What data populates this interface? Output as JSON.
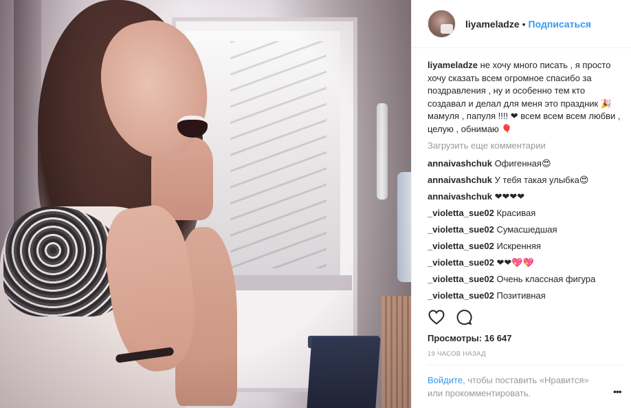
{
  "header": {
    "username": "liyameladze",
    "separator": "•",
    "follow_label": "Подписаться"
  },
  "caption": {
    "username": "liyameladze",
    "text": "не хочу много писать , я просто хочу сказать всем огромное спасибо за поздравления , ну и особенно тем кто создавал и делал для меня это праздник 🎉 мамуля , папуля !!!! ❤ всем всем всем любви , целую , обнимаю 🎈"
  },
  "load_more_label": "Загрузить еще комментарии",
  "comments": [
    {
      "username": "annaivashchuk",
      "text": "Офигенная😍"
    },
    {
      "username": "annaivashchuk",
      "text": "У тебя такая улыбка😍"
    },
    {
      "username": "annaivashchuk",
      "text": "❤❤❤❤"
    },
    {
      "username": "_violetta_sue02",
      "text": "Красивая"
    },
    {
      "username": "_violetta_sue02",
      "text": "Сумасшедшая"
    },
    {
      "username": "_violetta_sue02",
      "text": "Искренняя"
    },
    {
      "username": "_violetta_sue02",
      "text": "❤❤💖💖"
    },
    {
      "username": "_violetta_sue02",
      "text": "Очень классная фигура"
    },
    {
      "username": "_violetta_sue02",
      "text": "Позитивная"
    }
  ],
  "actions": {
    "like_icon": "heart-icon",
    "comment_icon": "speech-bubble-icon"
  },
  "views": {
    "label": "Просмотры:",
    "count": "16 647"
  },
  "timestamp": "19 часов назад",
  "login_prompt": {
    "link": "Войдите",
    "text": ", чтобы поставить «Нравится» или прокомментировать."
  },
  "more_options": "•••",
  "colors": {
    "link_blue": "#3897f0",
    "text_dark": "#262626",
    "text_muted": "#999999",
    "divider": "#efefef"
  }
}
